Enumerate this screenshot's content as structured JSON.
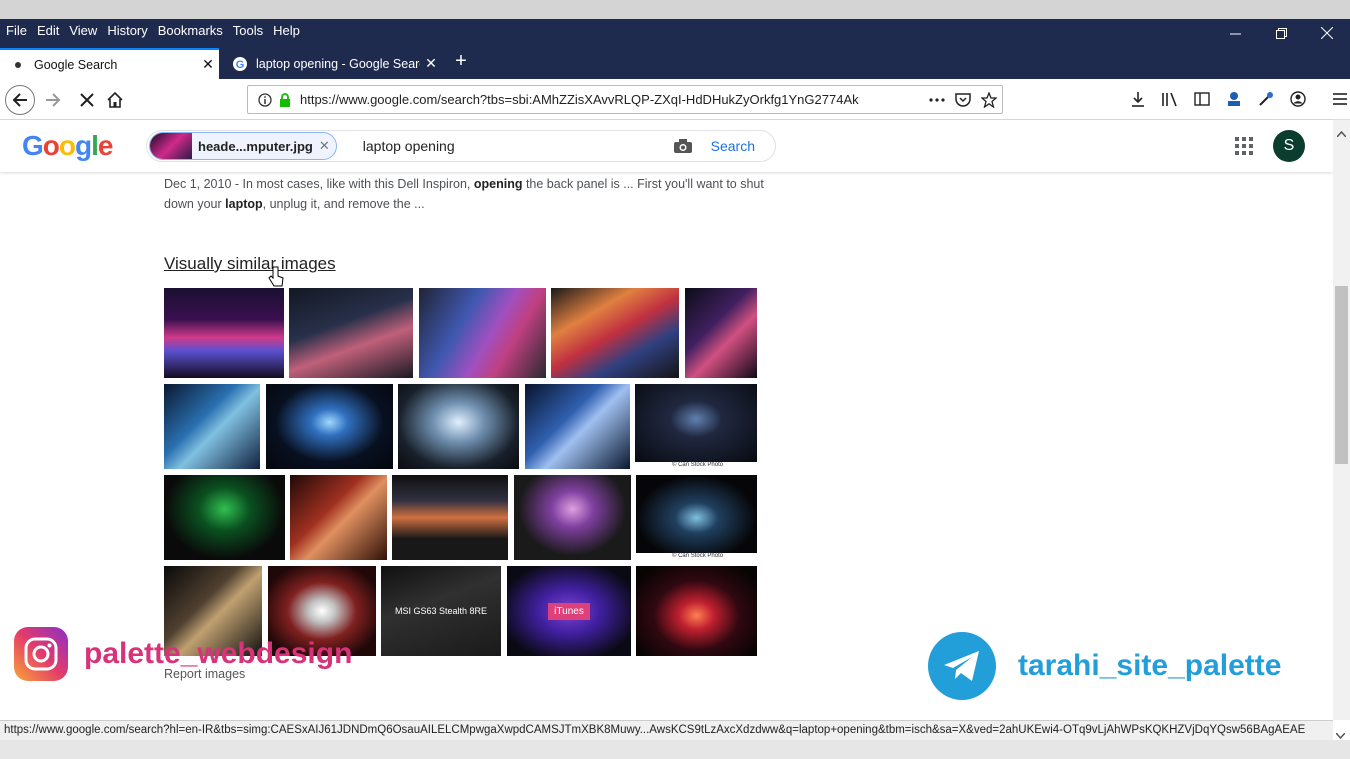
{
  "menu": [
    "File",
    "Edit",
    "View",
    "History",
    "Bookmarks",
    "Tools",
    "Help"
  ],
  "tabs": [
    {
      "title": "Google Search",
      "active": true
    },
    {
      "title": "laptop opening - Google Search",
      "active": false
    }
  ],
  "url": "https://www.google.com/search?tbs=sbi:AMhZZisXAvvRLQP-ZXqI-HdDHukZyOrkfg1YnG2774Ak",
  "google": {
    "logo": "Google",
    "image_chip": "heade...mputer.jpg",
    "query": "laptop opening",
    "search_label": "Search",
    "avatar_letter": "S"
  },
  "snippet": {
    "date": "Dec 1, 2010 - ",
    "t1": "In most cases, like with this Dell Inspiron, ",
    "b1": "opening",
    "t2": " the back panel is ... First you'll want to shut down your ",
    "b2": "laptop",
    "t3": ", unplug it, and remove the ..."
  },
  "similar": {
    "heading": "Visually similar images",
    "report": "Report images",
    "captions": {
      "itunes": "iTunes",
      "msi": "MSI GS63 Stealth 8RE",
      "canstock": "© Can Stock Photo"
    }
  },
  "status_url": "https://www.google.com/search?hl=en-IR&tbs=simg:CAESxAIJ61JDNDmQ6OsauAILELCMpwgaXwpdCAMSJTmXBK8Muwy...AwsKCS9tLzAxcXdzdww&q=laptop+opening&tbm=isch&sa=X&ved=2ahUKEwi4-OTq9vLjAhWPsKQKHZVjDqYQsw56BAgAEAE",
  "watermarks": {
    "instagram": "palette_webdesign",
    "telegram": "tarahi_site_palette"
  },
  "colors": {
    "chrome": "#1f2b4e",
    "accent": "#0a84ff",
    "link": "#1a73e8",
    "insta": "#d8337a",
    "tele": "#229ed9"
  }
}
